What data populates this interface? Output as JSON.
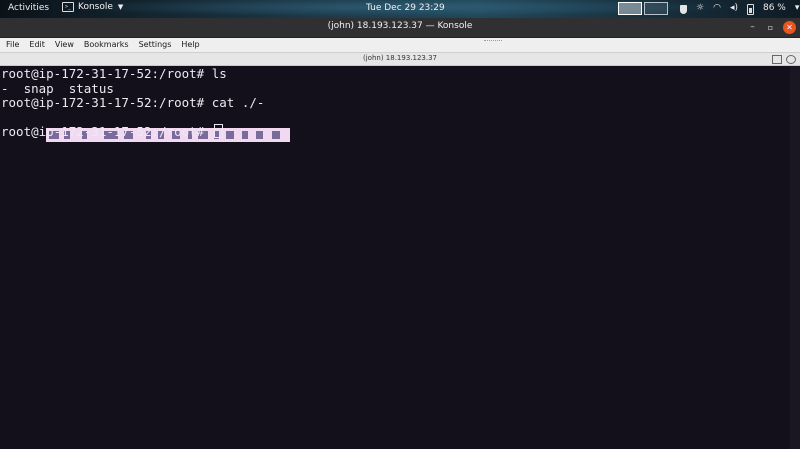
{
  "topbar": {
    "activities": "Activities",
    "app_name": "Konsole",
    "app_icon_text": ">_",
    "clock": "Tue Dec 29 23:29",
    "battery": "86 %"
  },
  "window": {
    "title": "(john) 18.193.123.37 — Konsole",
    "minimize": "–",
    "maximize": "▫",
    "close": "✕"
  },
  "menu": {
    "items": [
      "File",
      "Edit",
      "View",
      "Bookmarks",
      "Settings",
      "Help"
    ]
  },
  "tab": {
    "label": "(john) 18.193.123.37"
  },
  "terminal": {
    "lines": [
      "root@ip-172-31-17-52:/root# ls",
      "-  snap  status",
      "root@ip-172-31-17-52:/root# cat ./-",
      "",
      "root@ip-172-31-17-52:/root# "
    ]
  },
  "colors": {
    "terminal_bg": "#14101b",
    "terminal_fg": "#ece9f2",
    "close_button": "#e95420",
    "garbled_highlight": "#f1d9f2"
  },
  "icons": {
    "topbar_tray": [
      "shield-icon",
      "brightness-icon",
      "wifi-icon",
      "volume-icon",
      "battery-icon"
    ]
  }
}
